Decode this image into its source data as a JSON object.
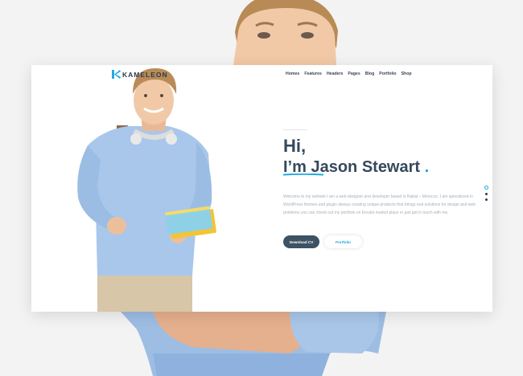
{
  "brand": {
    "logo_text": "KAMELEON",
    "accent": "#21a9e1",
    "dark": "#36495d"
  },
  "nav": {
    "items": [
      "Homes",
      "Features",
      "Headers",
      "Pages",
      "Blog",
      "Portfolio",
      "Shop"
    ]
  },
  "hero": {
    "greeting": "Hi,",
    "name_prefix": "I’m Jason Stewart",
    "name_dot": ".",
    "intro": "Welcome to my website I am a web designer and developer based in Rabat – Morocco. I am specialized in WordPress themes and plugin always creating unique products that brings real solutions for design and web problems you can check out my portfolio on Envato market place or just get in touch with me.",
    "primary_button": "Download CV",
    "secondary_button": "Portfolio"
  },
  "slider": {
    "dot_count": 3,
    "active_index": 0
  }
}
